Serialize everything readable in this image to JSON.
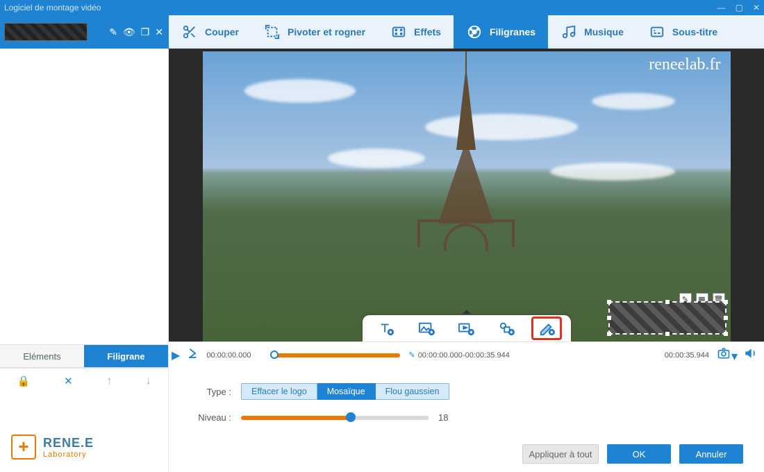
{
  "window": {
    "title": "Logiciel de montage vidéo"
  },
  "tabs": {
    "cut": "Couper",
    "rotate": "Pivoter et rogner",
    "effects": "Effets",
    "watermarks": "Filigranes",
    "music": "Musique",
    "subtitle": "Sous-titre"
  },
  "side_tabs": {
    "elements": "Eléments",
    "watermark": "Filigrane"
  },
  "preview": {
    "url_text": "reneelab.fr"
  },
  "timeline": {
    "start": "00:00:00.000",
    "range": "00:00:00.000-00:00:35.944",
    "end": "00:00:35.944"
  },
  "panel": {
    "type_label": "Type :",
    "level_label": "Niveau :",
    "options": {
      "erase": "Effacer le logo",
      "mosaic": "Mosaïque",
      "gauss": "Flou gaussien"
    },
    "level_value": "18"
  },
  "brand": {
    "line1": "RENE.E",
    "line2": "Laboratory"
  },
  "footer": {
    "apply_all": "Appliquer à tout",
    "ok": "OK",
    "cancel": "Annuler"
  }
}
